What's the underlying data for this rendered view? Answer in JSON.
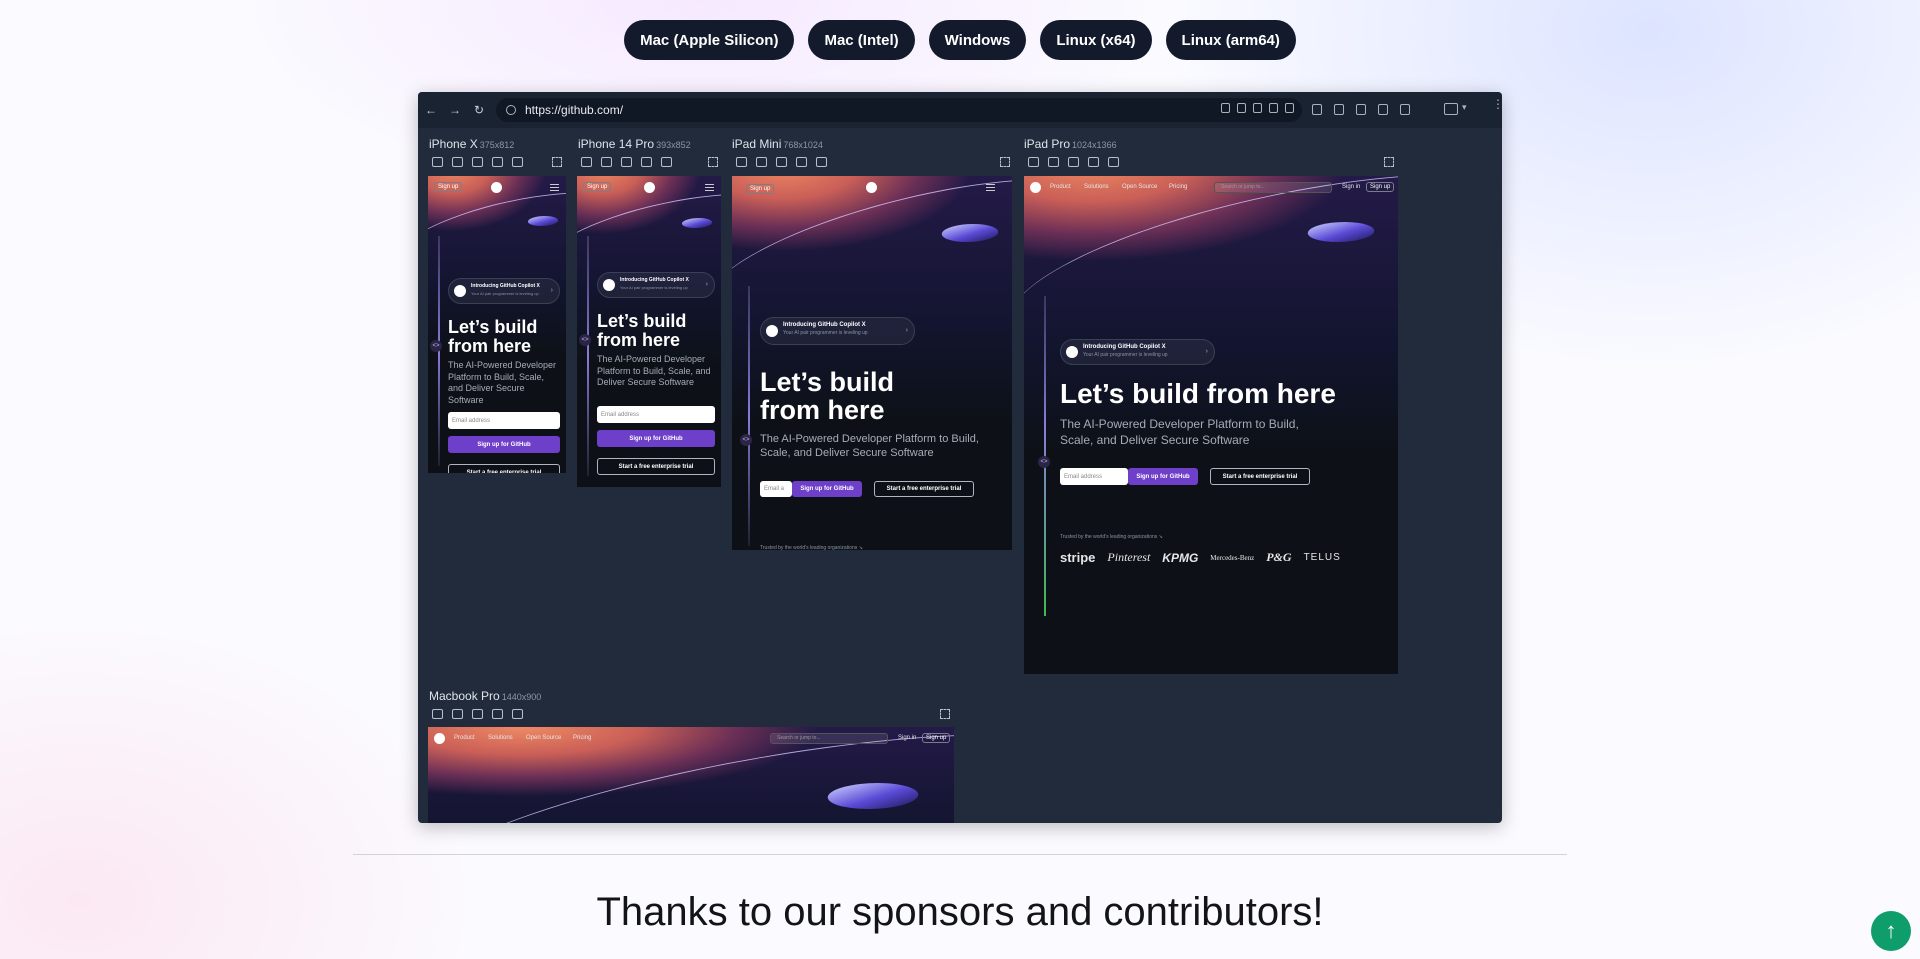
{
  "downloads": [
    {
      "label": "Mac (Apple Silicon)"
    },
    {
      "label": "Mac (Intel)"
    },
    {
      "label": "Windows"
    },
    {
      "label": "Linux (x64)"
    },
    {
      "label": "Linux (arm64)"
    }
  ],
  "browser": {
    "url": "https://github.com/"
  },
  "devices": {
    "iphonex": {
      "name": "iPhone X",
      "size": "375x812"
    },
    "iphone14": {
      "name": "iPhone 14 Pro",
      "size": "393x852"
    },
    "ipadmini": {
      "name": "iPad Mini",
      "size": "768x1024"
    },
    "ipadpro": {
      "name": "iPad Pro",
      "size": "1024x1366"
    },
    "macbook": {
      "name": "Macbook Pro",
      "size": "1440x900"
    }
  },
  "site": {
    "signup_small": "Sign up",
    "signin": "Sign in",
    "copilot_title": "Introducing GitHub Copilot X",
    "copilot_sub": "Your AI pair programmer is leveling up",
    "copilot_title_short": "Introducing GitHub Copilot X",
    "copilot_sub_short": "Your AI pair programmer is leveling up",
    "headline_l1": "Let’s build",
    "headline_l2": "from here",
    "headline_full": "Let’s build from here",
    "subhead": "The AI-Powered Developer Platform to Build, Scale, and Deliver Secure Software",
    "email_placeholder": "Email address",
    "email_short": "Email a",
    "signup_github": "Sign up for GitHub",
    "trial": "Start a free enterprise trial",
    "trusted": "Trusted by the world’s leading organizations ↘",
    "search": "Search or jump to...",
    "nav": [
      "Product",
      "Solutions",
      "Open Source",
      "Pricing"
    ],
    "logos": [
      "stripe",
      "Pinterest",
      "KPMG",
      "Mercedes-Benz",
      "P&G",
      "TELUS"
    ]
  },
  "footer": {
    "thanks": "Thanks to our sponsors and contributors!"
  }
}
